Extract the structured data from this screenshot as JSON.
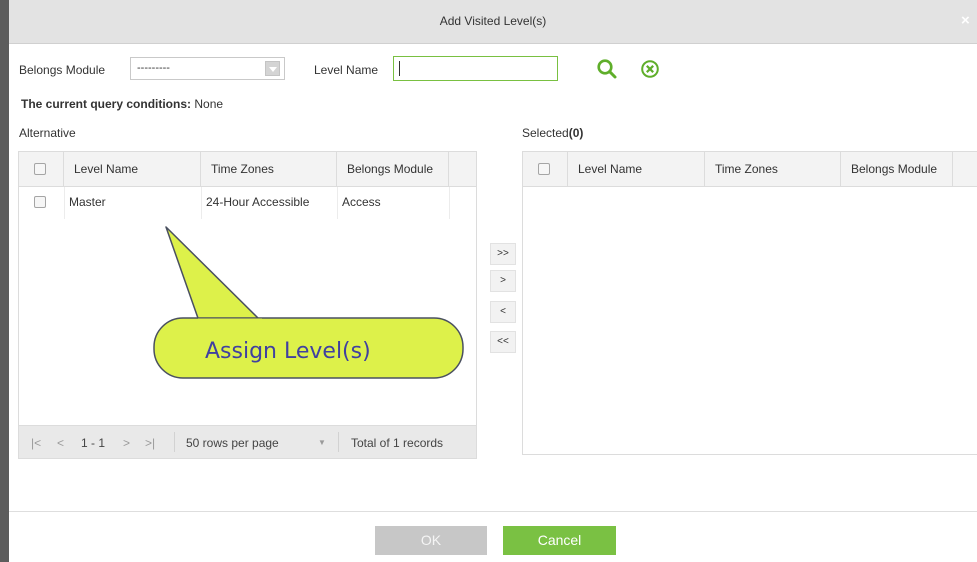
{
  "dialog": {
    "title": "Add Visited Level(s)",
    "close_glyph": "×"
  },
  "filters": {
    "module_label": "Belongs Module",
    "module_value": "---------",
    "level_name_label": "Level Name",
    "level_name_value": ""
  },
  "query": {
    "label": "The current query conditions:",
    "value": "None"
  },
  "alternative": {
    "label": "Alternative",
    "columns": [
      "Level Name",
      "Time Zones",
      "Belongs Module"
    ],
    "rows": [
      {
        "level_name": "Master",
        "time_zones": "24-Hour Accessible",
        "belongs_module": "Access"
      }
    ],
    "pager": {
      "first": "|<",
      "prev": "<",
      "range": "1 - 1",
      "next": ">",
      "last": ">|",
      "rows_per_page": "50 rows per page",
      "dropdown_glyph": "▼",
      "total": "Total of 1 records"
    }
  },
  "selected": {
    "label": "Selected",
    "count": "(0)",
    "columns": [
      "Level Name",
      "Time Zones",
      "Belongs Module"
    ]
  },
  "transfer": {
    "move_all_right": ">>",
    "move_right": ">",
    "move_left": "<",
    "move_all_left": "<<"
  },
  "callout": {
    "text": "Assign Level(s)"
  },
  "buttons": {
    "ok": "OK",
    "cancel": "Cancel"
  },
  "colors": {
    "accent_green": "#7ac143",
    "callout_fill": "#ddf14a",
    "callout_text": "#4040a0"
  },
  "icons": [
    "search-icon",
    "clear-icon",
    "close-icon",
    "chevron-down-icon"
  ]
}
